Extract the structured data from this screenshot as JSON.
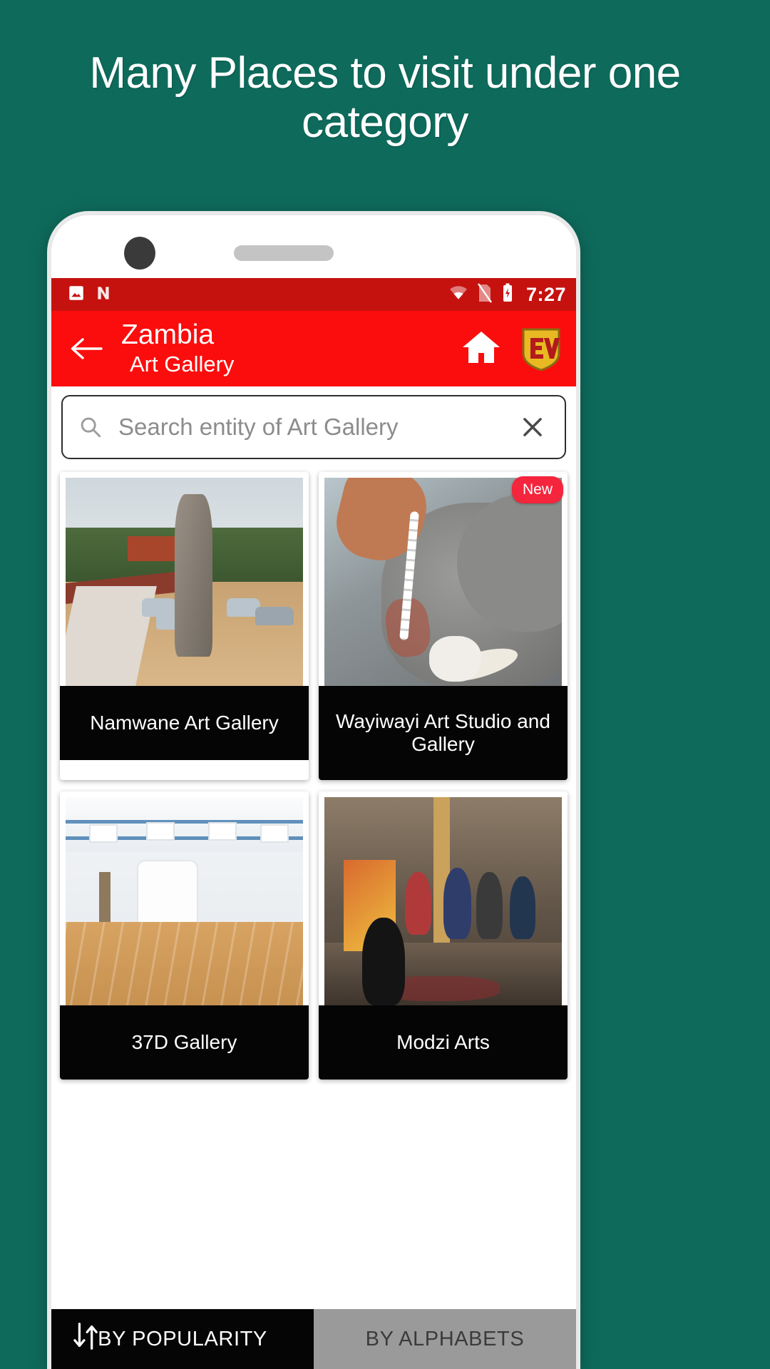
{
  "promo": {
    "headline": "Many Places to visit under one category",
    "background_color": "#0e6b5c",
    "text_color": "#ffffff"
  },
  "statusbar": {
    "time": "7:27",
    "background_color": "#c5120f",
    "icons": [
      "image-icon",
      "nova-launcher-icon",
      "wifi-icon",
      "sim-off-icon",
      "battery-charging-icon"
    ]
  },
  "appbar": {
    "background_color": "#fb0d0d",
    "back_label": "back-arrow",
    "title": "Zambia",
    "subtitle": "Art Gallery",
    "home_label": "Home",
    "brand_label": "EV",
    "brand_color": "#e8b923"
  },
  "search": {
    "placeholder": "Search entity of Art Gallery",
    "value": "",
    "clear_label": "×"
  },
  "grid": {
    "cards": [
      {
        "title": "Namwane Art Gallery",
        "badge": ""
      },
      {
        "title": "Wayiwayi Art Studio and Gallery",
        "badge": "New"
      },
      {
        "title": "37D Gallery",
        "badge": ""
      },
      {
        "title": "Modzi Arts",
        "badge": ""
      }
    ]
  },
  "sortbar": {
    "tabs": [
      {
        "label": "BY POPULARITY",
        "state": "active"
      },
      {
        "label": "BY ALPHABETS",
        "state": "inactive"
      }
    ],
    "active_color": "#050505",
    "inactive_color": "#9a9a9a"
  }
}
